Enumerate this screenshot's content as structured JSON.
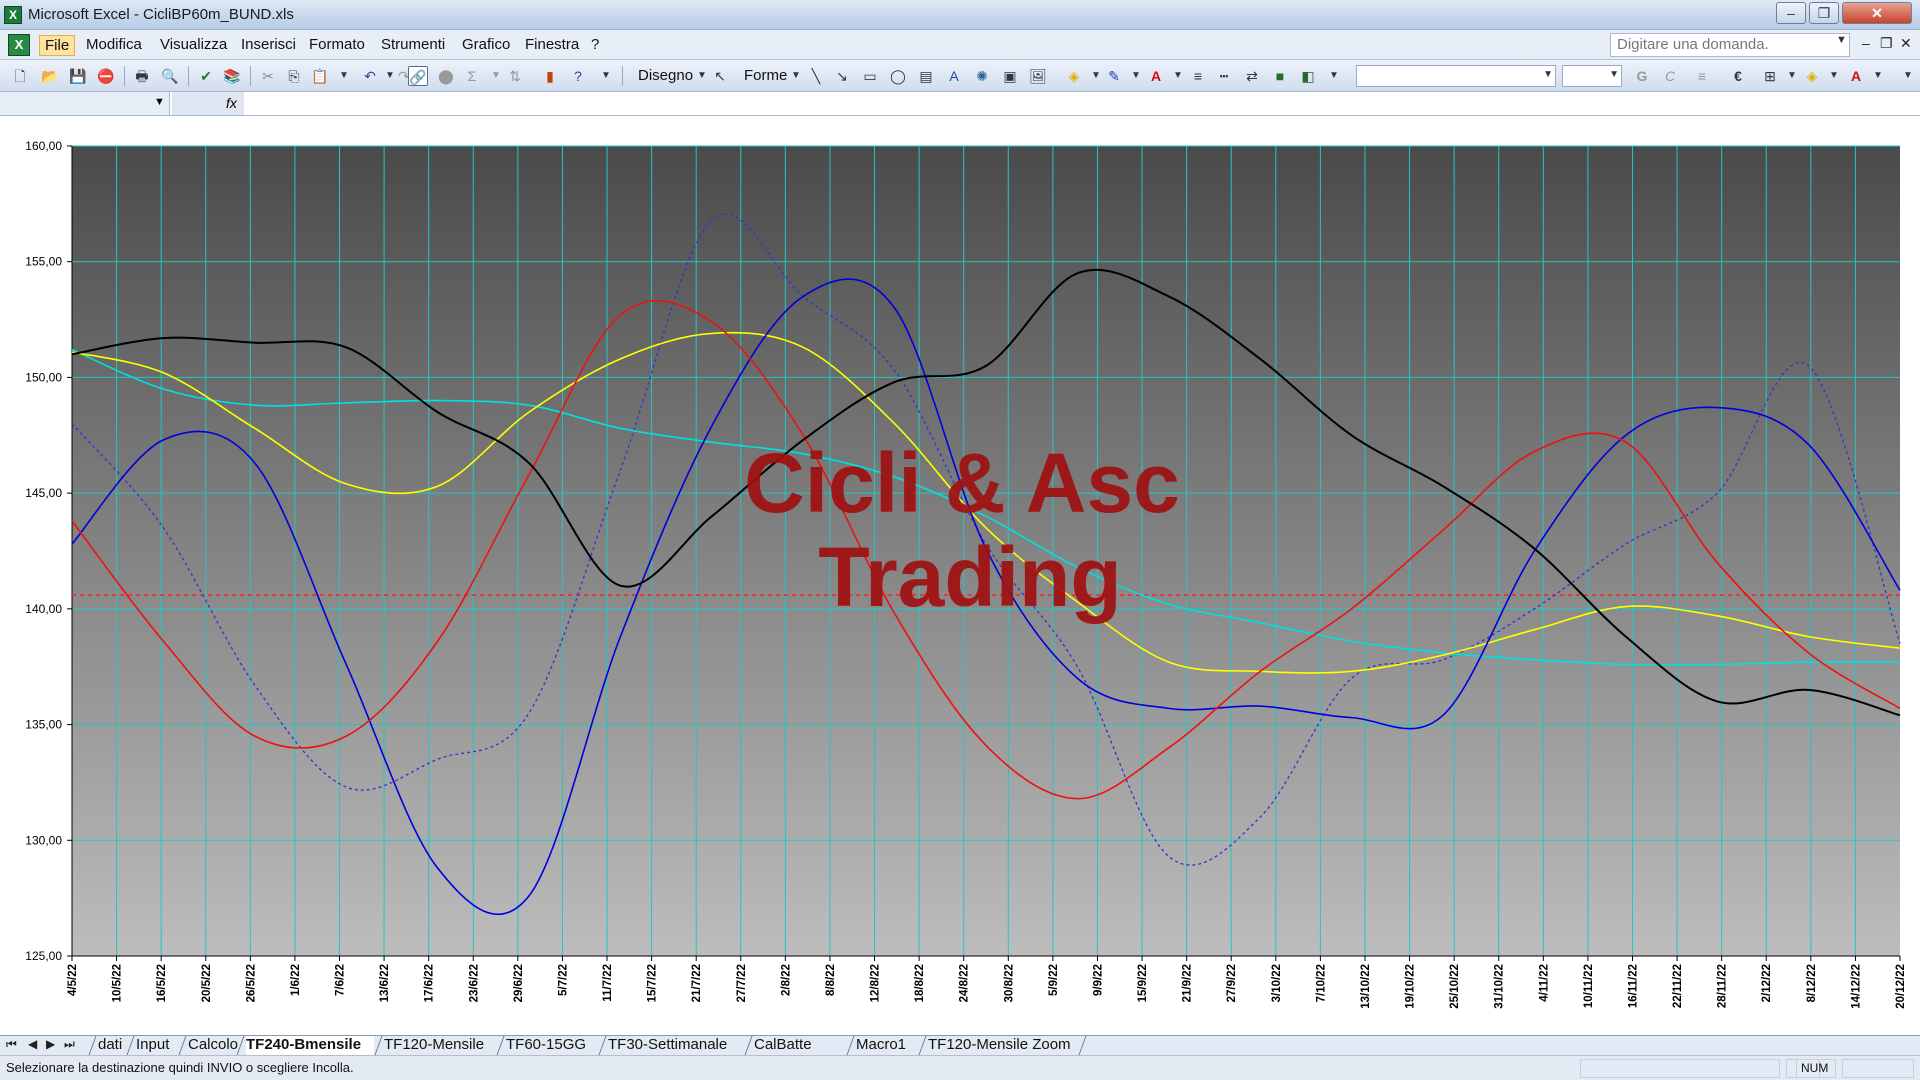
{
  "window": {
    "title": "Microsoft Excel - CicliBP60m_BUND.xls"
  },
  "menu": {
    "items": [
      "File",
      "Modifica",
      "Visualizza",
      "Inserisci",
      "Formato",
      "Strumenti",
      "Grafico",
      "Finestra",
      "?"
    ],
    "ask_placeholder": "Digitare una domanda."
  },
  "toolbar": {
    "drawing_label": "Disegno",
    "shapes_label": "Forme"
  },
  "formula": {
    "fx_label": "fx"
  },
  "chart_data": {
    "type": "line",
    "watermark": [
      "Cicli & Asc",
      "Trading"
    ],
    "ylim": [
      125,
      160
    ],
    "yticks": [
      "160,00",
      "155,00",
      "150,00",
      "145,00",
      "140,00",
      "135,00",
      "130,00",
      "125,00"
    ],
    "xticks": [
      "4/5/22",
      "10/5/22",
      "16/5/22",
      "20/5/22",
      "26/5/22",
      "1/6/22",
      "7/6/22",
      "13/6/22",
      "17/6/22",
      "23/6/22",
      "29/6/22",
      "5/7/22",
      "11/7/22",
      "15/7/22",
      "21/7/22",
      "27/7/22",
      "2/8/22",
      "8/8/22",
      "12/8/22",
      "18/8/22",
      "24/8/22",
      "30/8/22",
      "5/9/22",
      "9/9/22",
      "15/9/22",
      "21/9/22",
      "27/9/22",
      "3/10/22",
      "7/10/22",
      "13/10/22",
      "19/10/22",
      "25/10/22",
      "31/10/22",
      "4/11/22",
      "10/11/22",
      "16/11/22",
      "22/11/22",
      "28/11/22",
      "2/12/22",
      "8/12/22",
      "14/12/22",
      "20/12/22"
    ],
    "reference_line": 140.6,
    "x": [
      0,
      0.05,
      0.1,
      0.15,
      0.2,
      0.25,
      0.3,
      0.35,
      0.4,
      0.45,
      0.5,
      0.55,
      0.6,
      0.65,
      0.7,
      0.75,
      0.8,
      0.85,
      0.9,
      0.95,
      1
    ],
    "series": [
      {
        "color": "#000000",
        "width": 2,
        "dashed": false,
        "values": [
          151,
          151.7,
          151.5,
          151.3,
          148.5,
          146.3,
          141,
          144,
          147.3,
          149.8,
          150.5,
          154.5,
          153.5,
          150.8,
          147.5,
          145.3,
          142.6,
          138.8,
          136,
          136.5,
          135.4
        ]
      },
      {
        "color": "#3333cc",
        "width": 1.3,
        "dashed": true,
        "values": [
          148,
          143.5,
          136.7,
          132.3,
          133.5,
          135.5,
          146,
          156.8,
          153.5,
          150.3,
          142.8,
          137.5,
          129.3,
          131,
          137,
          137.8,
          140,
          142.8,
          145,
          150.5,
          138.5
        ]
      },
      {
        "color": "#0000dd",
        "width": 1.6,
        "dashed": false,
        "values": [
          142.8,
          147.3,
          146.3,
          137.6,
          128.8,
          127.6,
          138.8,
          147.9,
          153.5,
          153,
          142.6,
          137,
          135.7,
          135.8,
          135.3,
          135.4,
          142.5,
          147.5,
          148.7,
          147.1,
          140.8
        ]
      },
      {
        "color": "#ee1111",
        "width": 1.6,
        "dashed": false,
        "values": [
          143.8,
          138.6,
          134.5,
          134.5,
          138.6,
          145.8,
          152.7,
          152.4,
          147.5,
          139.8,
          134.1,
          131.8,
          134,
          137.3,
          140,
          143.4,
          146.8,
          147.2,
          142,
          138.1,
          135.7
        ]
      },
      {
        "color": "#ffff00",
        "width": 1.6,
        "dashed": false,
        "values": [
          151.1,
          150.2,
          147.8,
          145.4,
          145.3,
          148.5,
          150.8,
          151.9,
          151.3,
          148,
          143.5,
          140.3,
          137.7,
          137.3,
          137.3,
          138,
          139.1,
          140.1,
          139.7,
          138.8,
          138.3
        ]
      },
      {
        "color": "#00e0e0",
        "width": 1.6,
        "dashed": false,
        "values": [
          151.2,
          149.5,
          148.8,
          148.9,
          149,
          148.8,
          147.8,
          147.2,
          146.7,
          145.7,
          144,
          141.8,
          140.2,
          139.4,
          138.6,
          138.1,
          137.8,
          137.6,
          137.6,
          137.7,
          137.7
        ]
      }
    ]
  },
  "sheets": {
    "tabs": [
      "dati",
      "Input",
      "Calcolo",
      "TF240-Bmensile",
      "TF120-Mensile",
      "TF60-15GG",
      "TF30-Settimanale",
      "CalBatte",
      "Macro1",
      "TF120-Mensile Zoom"
    ],
    "active": "TF240-Bmensile"
  },
  "status": {
    "message": "Selezionare la destinazione quindi INVIO o scegliere Incolla.",
    "num": "NUM"
  }
}
